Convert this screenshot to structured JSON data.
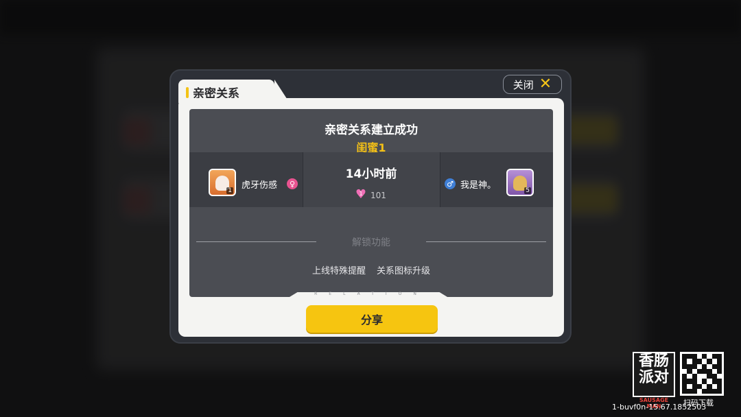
{
  "dialog": {
    "title": "亲密关系",
    "close_label": "关闭",
    "success_title": "亲密关系建立成功",
    "relation_level": "闺蜜1",
    "left_player": {
      "name": "虎牙伤感",
      "level": "1",
      "gender": "♀"
    },
    "right_player": {
      "name": "我是神。",
      "level": "5",
      "gender": "♂"
    },
    "time_ago": "14小时前",
    "intimacy_level": "1",
    "intimacy_value": "101",
    "unlock_title": "解锁功能",
    "features": [
      "上线特殊提醒",
      "关系图标升级"
    ],
    "panel_watermark": "RELATION",
    "share_label": "分享"
  },
  "overlay": {
    "logo_text": "香肠派对",
    "logo_subtext": "SAUSAGE MAN",
    "qr_label": "扫码下载",
    "build_info": "1-buvf0n-15.67.1852503"
  },
  "colors": {
    "accent_yellow": "#f6c510",
    "female_pink": "#e85390",
    "male_blue": "#3f7fd6",
    "heart_pink": "#f06eb6"
  }
}
